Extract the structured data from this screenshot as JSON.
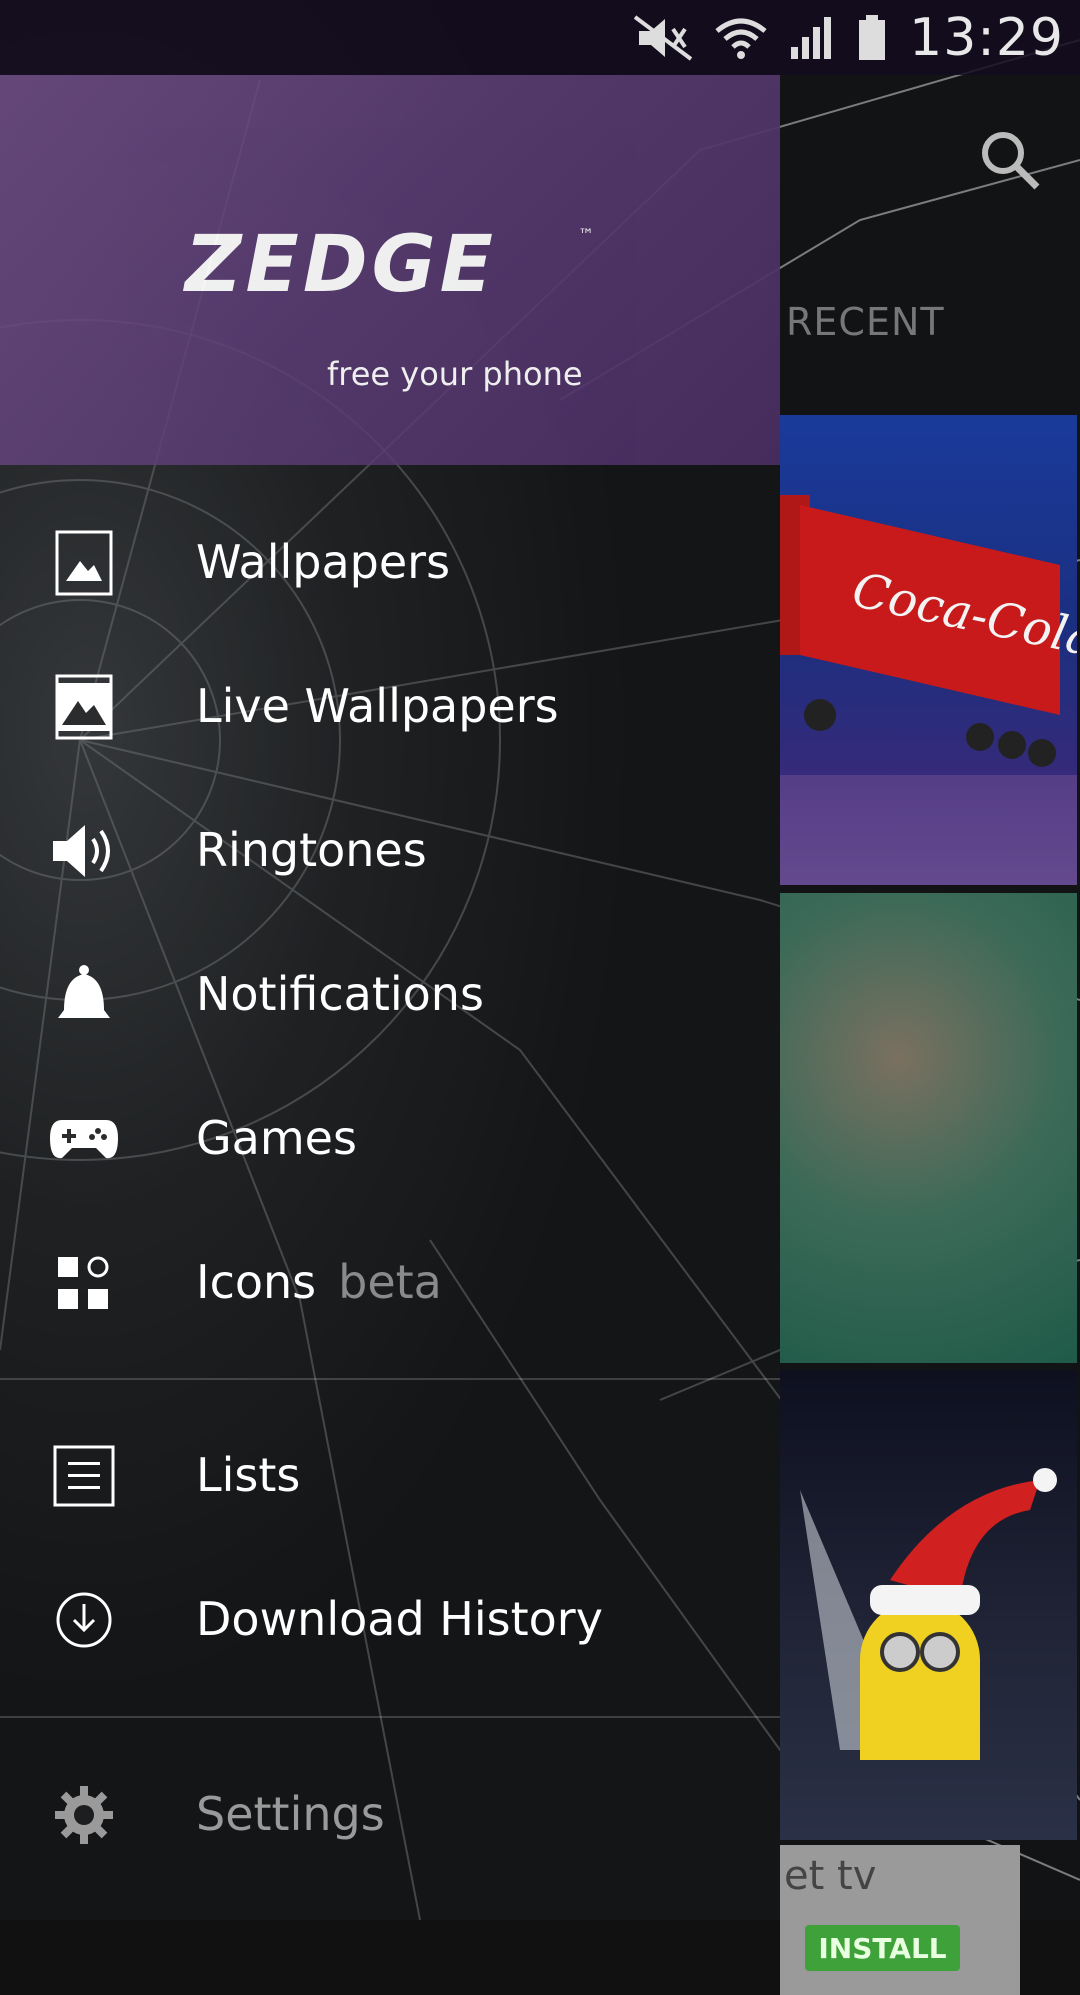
{
  "status_bar": {
    "time": "13:29",
    "icons": [
      "mute-icon",
      "wifi-icon",
      "signal-icon",
      "battery-icon"
    ]
  },
  "drawer": {
    "logo_text": "ZEDGE",
    "logo_tm": "™",
    "tagline": "free your phone",
    "menu": [
      {
        "label": "Wallpapers",
        "icon": "wallpaper-icon"
      },
      {
        "label": "Live Wallpapers",
        "icon": "live-wallpaper-icon"
      },
      {
        "label": "Ringtones",
        "icon": "speaker-icon"
      },
      {
        "label": "Notifications",
        "icon": "bell-icon"
      },
      {
        "label": "Games",
        "icon": "gamepad-icon"
      },
      {
        "label": "Icons",
        "icon": "icons-grid-icon",
        "badge": "beta"
      }
    ],
    "secondary": [
      {
        "label": "Lists",
        "icon": "list-icon"
      },
      {
        "label": "Download History",
        "icon": "download-icon"
      }
    ],
    "settings": {
      "label": "Settings",
      "icon": "gear-icon"
    }
  },
  "content": {
    "tab_label": "RECENT",
    "ad": {
      "title": "et tv",
      "button": "INSTALL"
    }
  },
  "colors": {
    "header_purple": "#553a6e",
    "install_green": "#3fa13a"
  }
}
